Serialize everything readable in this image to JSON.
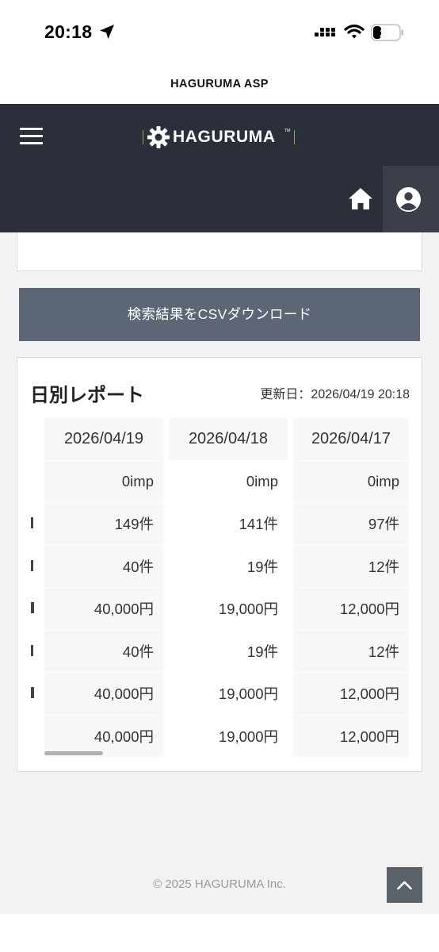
{
  "status_bar": {
    "time": "20:18",
    "battery": "27"
  },
  "site": {
    "title": "HAGURUMA ASP"
  },
  "header": {
    "logo_text": "HAGURUMA"
  },
  "csv_button": {
    "label": "検索結果をCSVダウンロード"
  },
  "report": {
    "title": "日別レポート",
    "updated": "更新日：2026/04/19 20:18",
    "columns": [
      "2026/04/19",
      "2026/04/18",
      "2026/04/17"
    ],
    "rows": [
      [
        "0imp",
        "0imp",
        "0imp"
      ],
      [
        "149件",
        "141件",
        "97件"
      ],
      [
        "40件",
        "19件",
        "12件"
      ],
      [
        "40,000円",
        "19,000円",
        "12,000円"
      ],
      [
        "40件",
        "19件",
        "12件"
      ],
      [
        "40,000円",
        "19,000円",
        "12,000円"
      ],
      [
        "40,000円",
        "19,000円",
        "12,000円"
      ]
    ]
  },
  "footer": {
    "copyright": "© 2025 HAGURUMA Inc."
  },
  "colors": {
    "header_bg": "#2a2f39",
    "button_bg": "#5c6675",
    "page_bg": "#f2f2f2",
    "logo_accent": "#7ab648"
  },
  "icons": [
    "location-arrow-icon",
    "signal-icon",
    "wifi-icon",
    "battery-icon",
    "menu-icon",
    "gear-icon",
    "home-icon",
    "user-circle-icon",
    "chevron-up-icon"
  ]
}
